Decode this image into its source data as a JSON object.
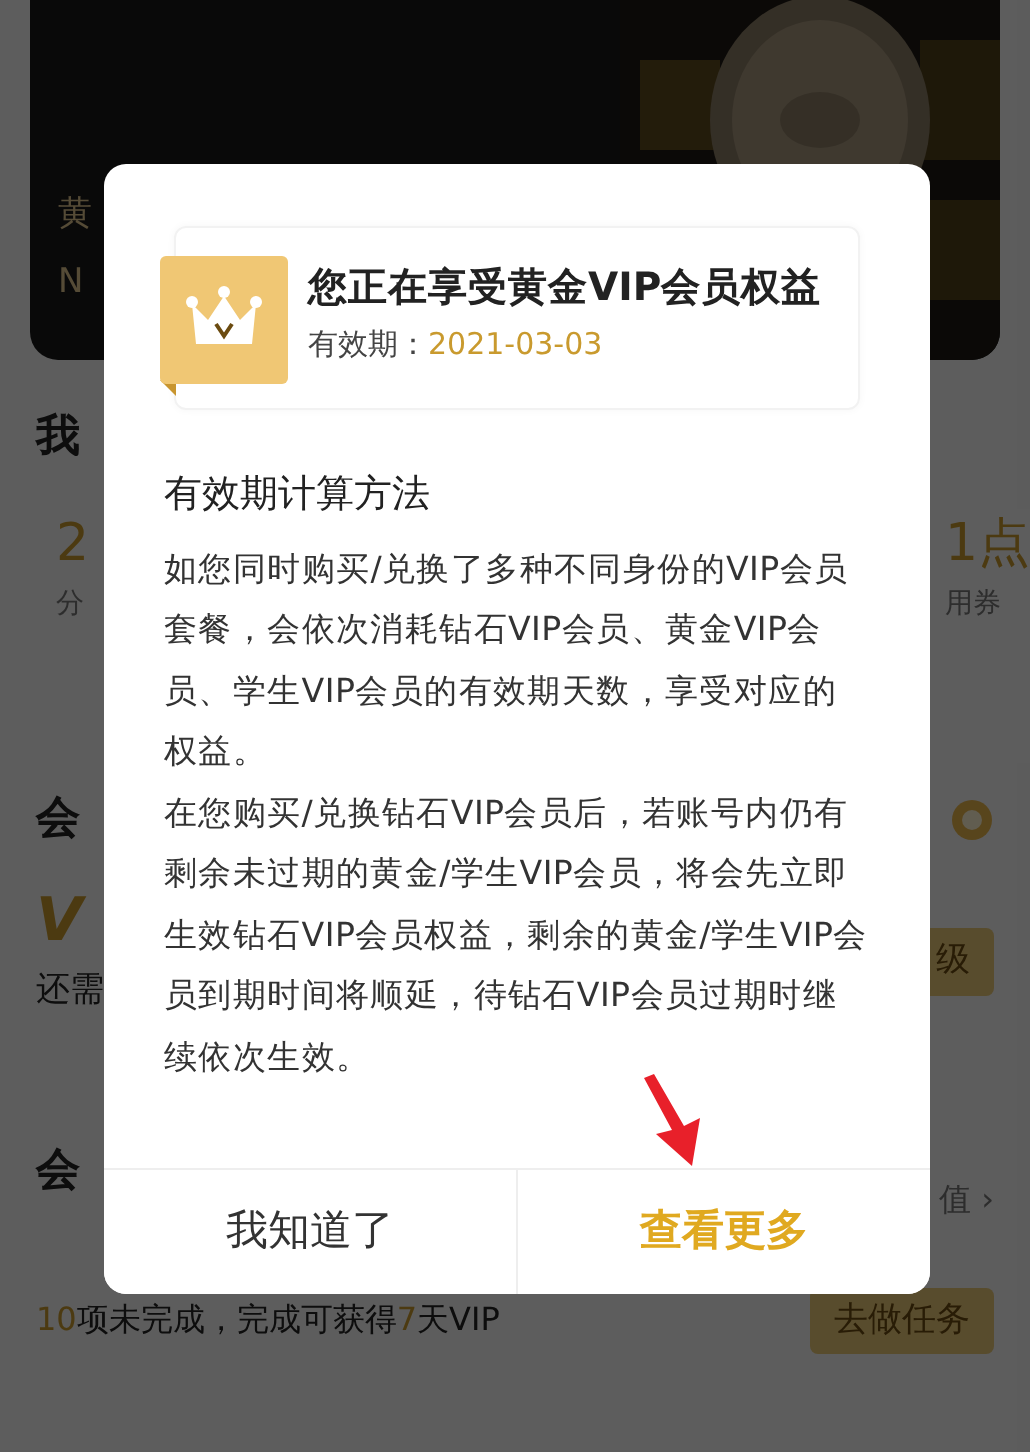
{
  "header_card": {
    "fragments": [
      "黄",
      "N"
    ]
  },
  "background": {
    "my_heading": "我",
    "stats": [
      {
        "value": "2",
        "label": "分"
      },
      {
        "value": "1点",
        "label": "用券"
      }
    ],
    "level_heading": "会",
    "level_badge": "V",
    "level_hint": "还需",
    "upgrade_button": "级",
    "task_heading": "会",
    "task_link": "值 ›",
    "task_text": [
      {
        "text": "10",
        "highlight": true
      },
      {
        "text": "项未完成，完成可获得",
        "highlight": false
      },
      {
        "text": "7",
        "highlight": true
      },
      {
        "text": "天VIP",
        "highlight": false
      }
    ],
    "task_button": "去做任务"
  },
  "dialog": {
    "card_title": "您正在享受黄金VIP会员权益",
    "validity_label": "有效期：",
    "validity_date": "2021-03-03",
    "section_title": "有效期计算方法",
    "paragraphs": [
      "如您同时购买/兑换了多种不同身份的VIP会员套餐，会依次消耗钻石VIP会员、黄金VIP会员、学生VIP会员的有效期天数，享受对应的权益。",
      "在您购买/兑换钻石VIP会员后，若账号内仍有剩余未过期的黄金/学生VIP会员，将会先立即生效钻石VIP会员权益，剩余的黄金/学生VIP会员到期时间将顺延，待钻石VIP会员过期时继续依次生效。"
    ],
    "buttons": [
      {
        "label": "我知道了",
        "kind": "secondary"
      },
      {
        "label": "查看更多",
        "kind": "primary"
      }
    ]
  }
}
